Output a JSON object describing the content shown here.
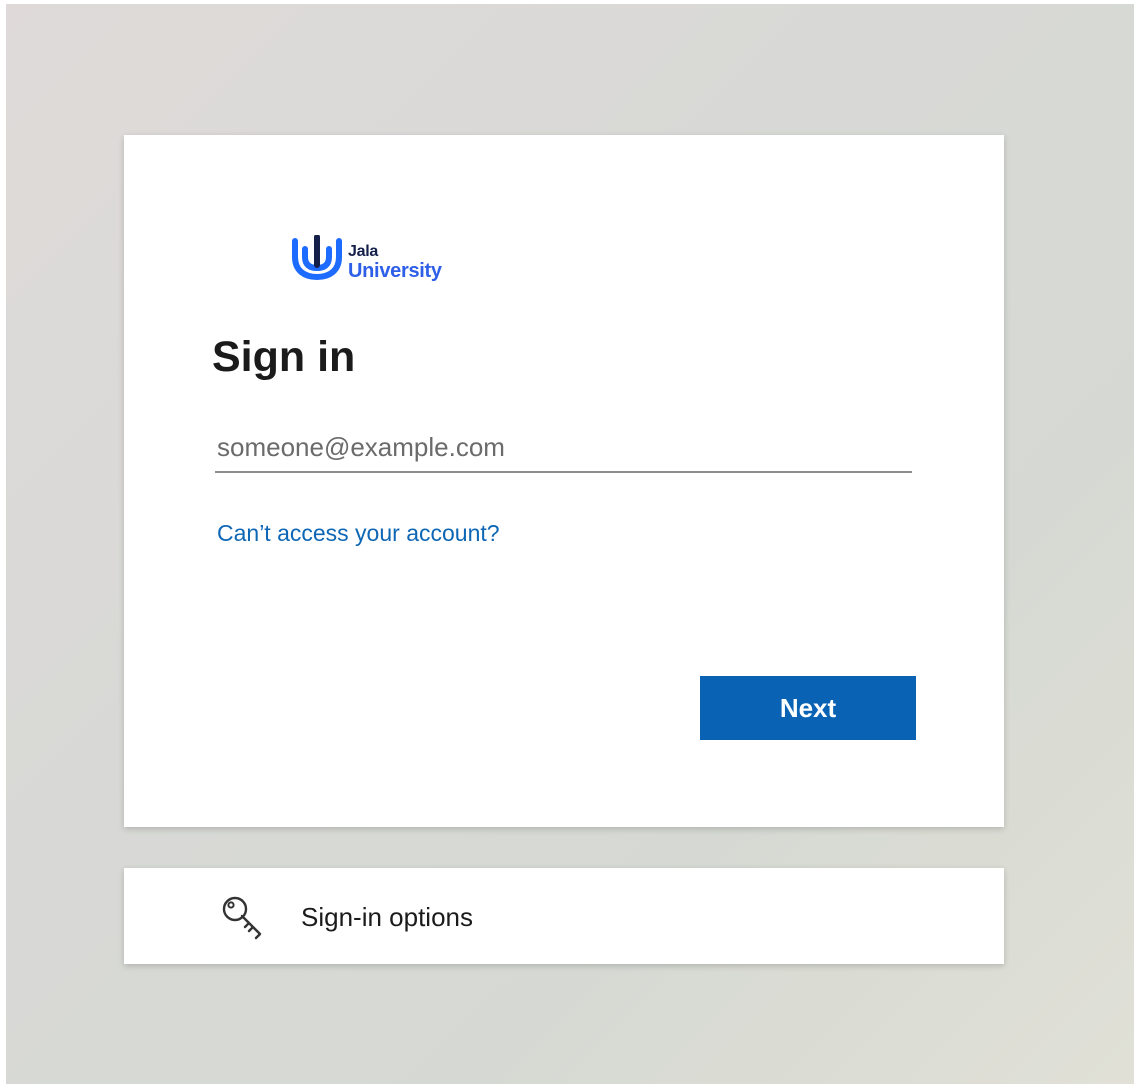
{
  "logo": {
    "top_text": "Jala",
    "bottom_text": "University",
    "colors": {
      "dark": "#15204a",
      "blue": "#2d5fe8",
      "bright": "#1e6bff"
    }
  },
  "signin": {
    "title": "Sign in",
    "email_placeholder": "someone@example.com",
    "email_value": "",
    "cant_access_link": "Can’t access your account?",
    "next_button": "Next"
  },
  "options": {
    "icon": "key-icon",
    "label": "Sign-in options"
  },
  "colors": {
    "accent": "#0a62b4",
    "link": "#0e67b5",
    "text": "#1b1b1b"
  }
}
